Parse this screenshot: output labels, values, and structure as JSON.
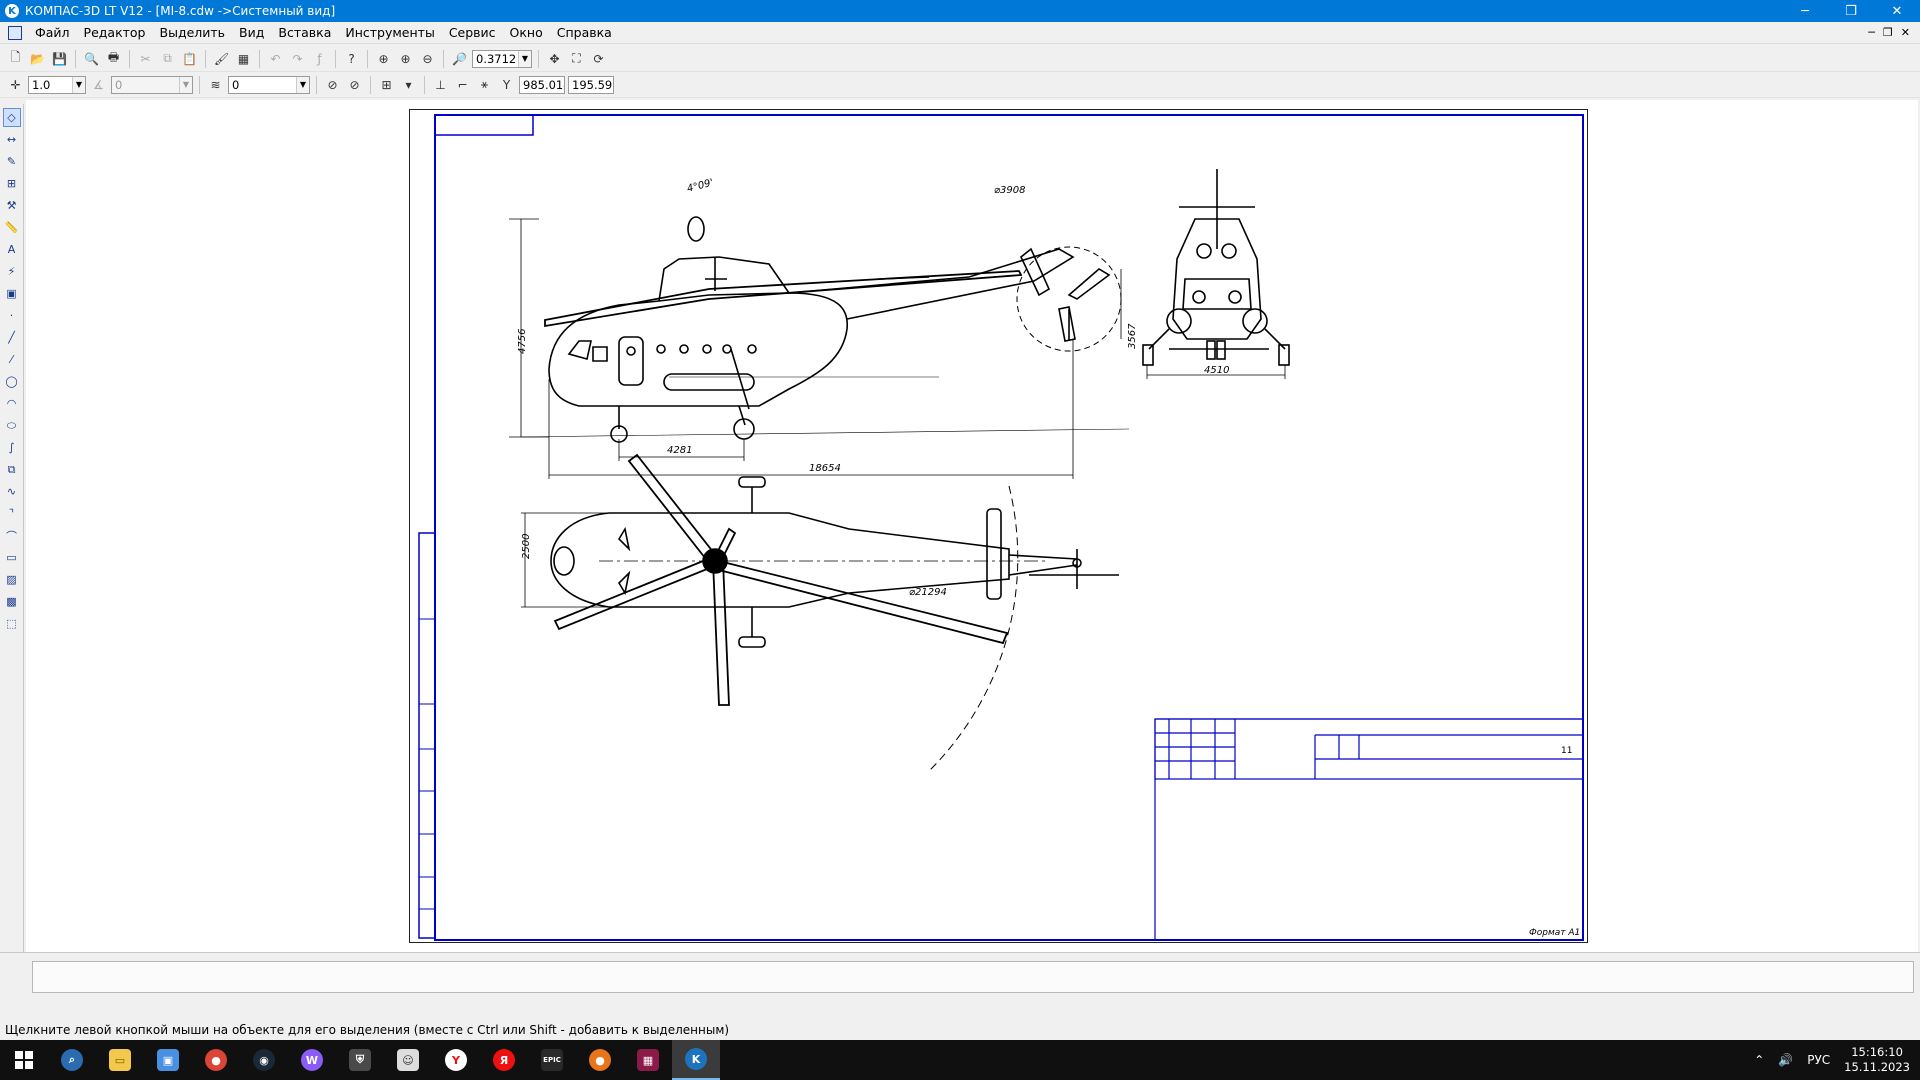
{
  "window": {
    "title": "КОМПАС-3D LT V12 - [MI-8.cdw ->Системный вид]",
    "controls": [
      "─",
      "❐",
      "✕"
    ]
  },
  "menu": {
    "items": [
      "Файл",
      "Редактор",
      "Выделить",
      "Вид",
      "Вставка",
      "Инструменты",
      "Сервис",
      "Окно",
      "Справка"
    ],
    "mdi_controls": [
      "─",
      "❐",
      "✕"
    ]
  },
  "toolbar1": {
    "zoom_value": "0.3712"
  },
  "toolbar2": {
    "step_value": "1.0",
    "angle_value": "0",
    "layer_value": "0",
    "coord_label": "Y",
    "coord_x": "985.014",
    "coord_y": "195.596"
  },
  "drawing": {
    "file": "MI-8.cdw",
    "dims": {
      "rotor_diameter": "⌀21294",
      "tail_rotor_diameter": "⌀3908",
      "height": "4756",
      "tail_height": "3567",
      "wheelbase": "4281",
      "length": "18654",
      "track": "4510",
      "width": "2500",
      "rotor_tilt": "4°09'"
    },
    "title_block": {
      "sheet_count": "11",
      "format_label": "Формат А1"
    }
  },
  "status": {
    "hint": "Щелкните левой кнопкой мыши на объекте для его выделения (вместе с Ctrl или Shift - добавить к выделенным)"
  },
  "taskbar": {
    "language": "РУС",
    "time": "15:16:10",
    "date": "15.11.2023"
  },
  "colors": {
    "titlebar": "#0078d7",
    "frame": "#0000cc",
    "taskbar": "#101010"
  }
}
